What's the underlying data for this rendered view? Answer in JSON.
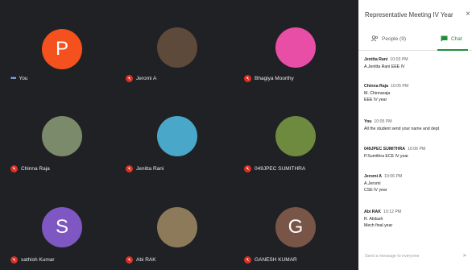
{
  "participants": [
    {
      "name": "You",
      "initial": "P",
      "color": "#f4511e",
      "muted": false
    },
    {
      "name": "Jeromi A",
      "initial": "",
      "color": "#5d4a3a",
      "muted": true
    },
    {
      "name": "Bhagiya Moorthy",
      "initial": "",
      "color": "#e84ea6",
      "muted": true
    },
    {
      "name": "Chinna Raja",
      "initial": "",
      "color": "#7a8a6a",
      "muted": true
    },
    {
      "name": "Jenitta Rani",
      "initial": "",
      "color": "#49a7c9",
      "muted": true
    },
    {
      "name": "049JPEC SUMITHRA",
      "initial": "",
      "color": "#6d8a3f",
      "muted": true
    },
    {
      "name": "sathish Kumar",
      "initial": "S",
      "color": "#7e57c2",
      "muted": true
    },
    {
      "name": "Abi RAK",
      "initial": "",
      "color": "#8c7a5a",
      "muted": true
    },
    {
      "name": "GANESH KUMAR",
      "initial": "G",
      "color": "#795548",
      "muted": true
    }
  ],
  "panel": {
    "title": "Representative Meeting IV Year",
    "close_icon": "×",
    "people_label": "People (9)",
    "chat_label": "Chat"
  },
  "messages": [
    {
      "sender": "Jenitta Rani",
      "time": "10:03 PM",
      "lines": [
        "A.Jenitta Rani EEE IV"
      ]
    },
    {
      "sender": "Chinna Raja",
      "time": "10:05 PM",
      "lines": [
        "M. Chinnaraja",
        "EEE IV year"
      ]
    },
    {
      "sender": "You",
      "time": "10:05 PM",
      "lines": [
        "All the student send your name and dept"
      ]
    },
    {
      "sender": "049JPEC SUMITHRA",
      "time": "10:06 PM",
      "lines": [
        "P.Sumithra ECE IV year"
      ]
    },
    {
      "sender": "Jeromi A",
      "time": "10:06 PM",
      "lines": [
        "A.Jeromi",
        "CSE IV year"
      ]
    },
    {
      "sender": "Abi RAK",
      "time": "10:12 PM",
      "lines": [
        "R. Abilash",
        "Mech final year"
      ]
    }
  ],
  "input_placeholder": "Send a message to everyone"
}
